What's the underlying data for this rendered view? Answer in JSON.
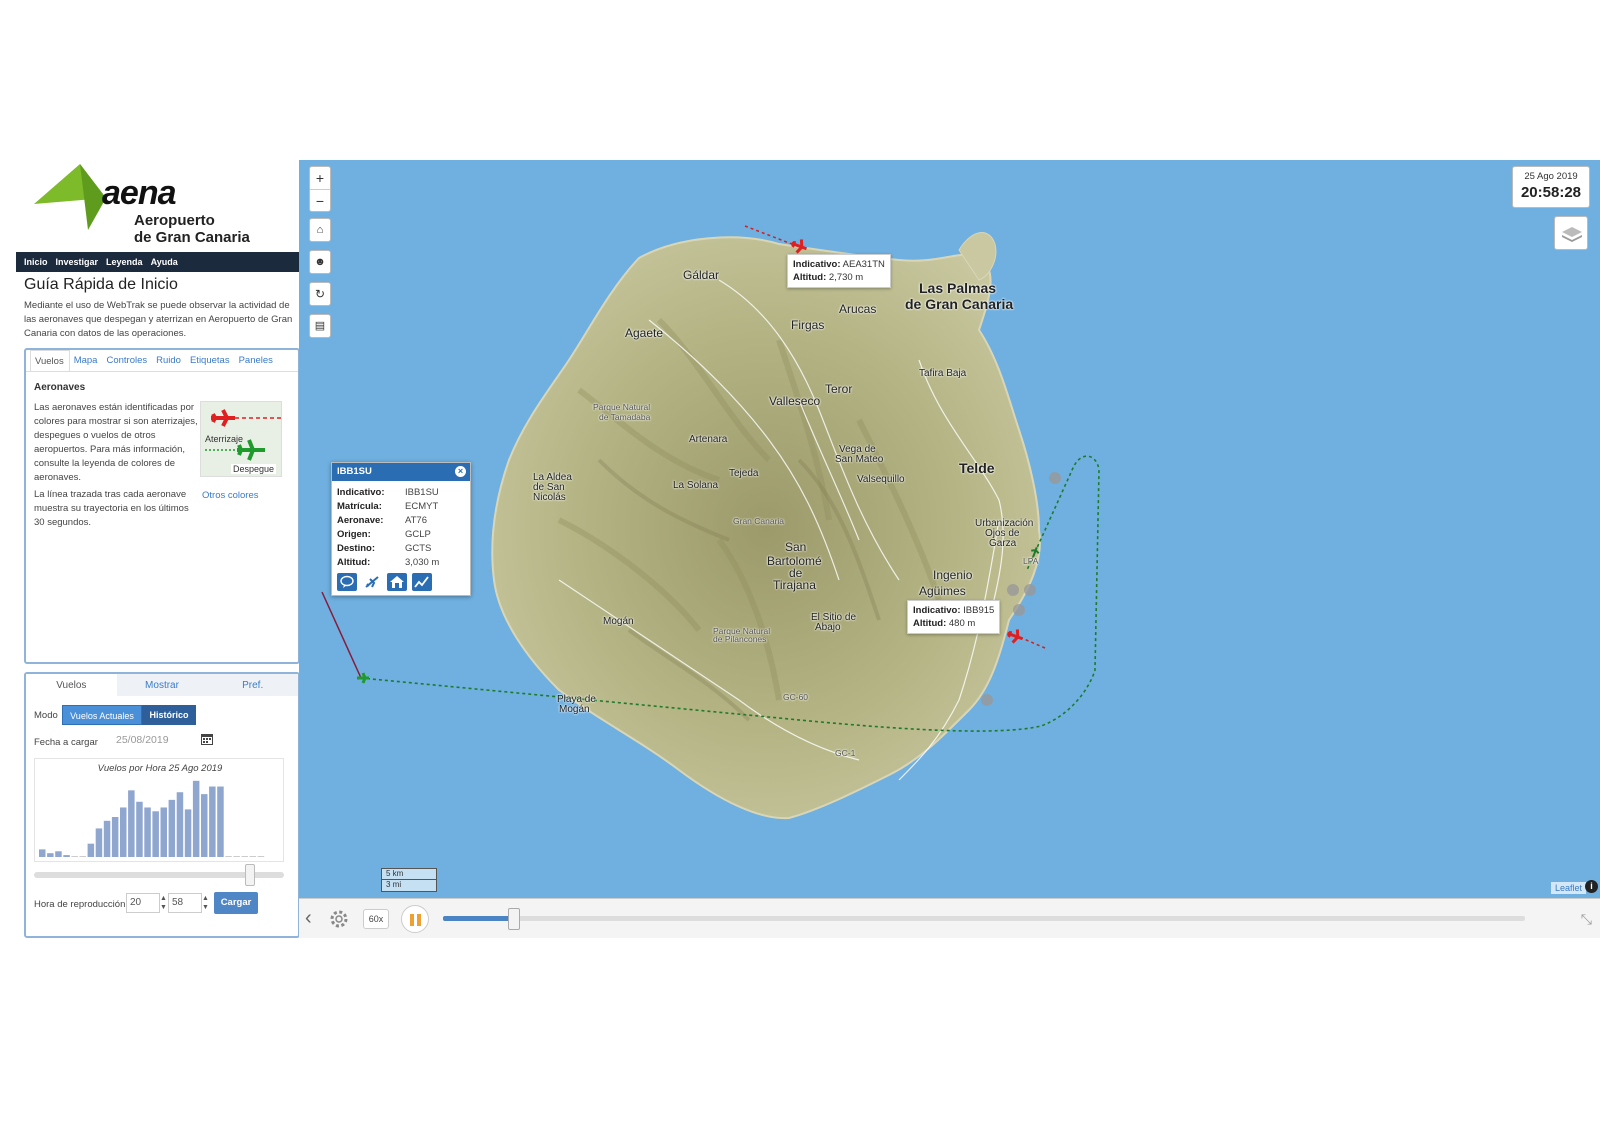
{
  "logo": {
    "brand": "aena",
    "airport_line1": "Aeropuerto",
    "airport_line2": "de Gran Canaria"
  },
  "topnav": [
    "Inicio",
    "Investigar",
    "Leyenda",
    "Ayuda"
  ],
  "guide": {
    "title": "Guía Rápida de Inicio",
    "text": "Mediante el uso de WebTrak se puede observar la actividad de las aeronaves que despegan y aterrizan en Aeropuerto de Gran Canaria con datos de las operaciones."
  },
  "help_panel": {
    "tabs": [
      "Vuelos",
      "Mapa",
      "Controles",
      "Ruido",
      "Etiquetas",
      "Paneles"
    ],
    "active_tab": 0,
    "heading": "Aeronaves",
    "p1": "Las aeronaves están identificadas por colores para mostrar si son aterrizajes, despegues o vuelos de otros aeropuertos. Para más información, consulte la leyenda de colores de aeronaves.",
    "p2": "La línea trazada tras cada aeronave muestra su trayectoria en los últimos 30 segundos.",
    "legend_landing": "Aterrizaje",
    "legend_takeoff": "Despegue",
    "other_colors": "Otros colores"
  },
  "flights_panel": {
    "tabs": [
      "Vuelos",
      "Mostrar",
      "Pref."
    ],
    "active_tab": 0,
    "mode_label": "Modo",
    "mode_current": "Vuelos Actuales",
    "mode_historic": "Histórico",
    "date_label": "Fecha a cargar",
    "date_value": "25/08/2019",
    "histogram_title": "Vuelos por Hora 25 Ago 2019",
    "histogram_values": [
      4,
      2,
      3,
      1,
      0,
      0,
      7,
      15,
      19,
      21,
      26,
      35,
      29,
      26,
      24,
      26,
      30,
      34,
      25,
      40,
      33,
      37,
      37,
      0,
      0,
      0,
      0,
      0
    ],
    "slider_fraction": 0.88,
    "hour_label": "Hora de reproducción",
    "hour": "20",
    "minute": "58",
    "load_button": "Cargar"
  },
  "map": {
    "clock_date": "25 Ago 2019",
    "clock_time": "20:58:28",
    "places": [
      {
        "name": "Gáldar",
        "cls": "mid"
      },
      {
        "name": "Arucas",
        "cls": "mid"
      },
      {
        "name": "Firgas",
        "cls": "mid"
      },
      {
        "name": "Agaete",
        "cls": "mid"
      },
      {
        "name": "Las Palmas",
        "cls": "big"
      },
      {
        "name": "de Gran Canaria",
        "cls": "big"
      },
      {
        "name": "Tafira Baja",
        "cls": ""
      },
      {
        "name": "Teror",
        "cls": "mid"
      },
      {
        "name": "Valleseco",
        "cls": "mid"
      },
      {
        "name": "Parque Natural",
        "cls": "small"
      },
      {
        "name": "de Tamadaba",
        "cls": "small"
      },
      {
        "name": "Artenara",
        "cls": ""
      },
      {
        "name": "Vega de",
        "cls": ""
      },
      {
        "name": "San Mateo",
        "cls": ""
      },
      {
        "name": "Valsequillo",
        "cls": ""
      },
      {
        "name": "Telde",
        "cls": "big"
      },
      {
        "name": "La Aldea",
        "cls": ""
      },
      {
        "name": "de San",
        "cls": ""
      },
      {
        "name": "Nicolás",
        "cls": ""
      },
      {
        "name": "La Solana",
        "cls": ""
      },
      {
        "name": "Tejeda",
        "cls": ""
      },
      {
        "name": "Gran Canaria",
        "cls": "small"
      },
      {
        "name": "Urbanización",
        "cls": ""
      },
      {
        "name": "Ojos de",
        "cls": ""
      },
      {
        "name": "Garza",
        "cls": ""
      },
      {
        "name": "San",
        "cls": "mid"
      },
      {
        "name": "Bartolomé",
        "cls": "mid"
      },
      {
        "name": "de",
        "cls": "mid"
      },
      {
        "name": "Tirajana",
        "cls": "mid"
      },
      {
        "name": "Ingenio",
        "cls": "mid"
      },
      {
        "name": "Agüimes",
        "cls": "mid"
      },
      {
        "name": "Mogán",
        "cls": ""
      },
      {
        "name": "El Sitio de",
        "cls": ""
      },
      {
        "name": "Abajo",
        "cls": ""
      },
      {
        "name": "Parque Natural",
        "cls": "small"
      },
      {
        "name": "de Pilancones",
        "cls": "small"
      },
      {
        "name": "Playa de",
        "cls": ""
      },
      {
        "name": "Mogán",
        "cls": ""
      },
      {
        "name": "GC-60",
        "cls": "small"
      },
      {
        "name": "GC-1",
        "cls": "small"
      },
      {
        "name": "LPA",
        "cls": "small"
      }
    ],
    "tooltip_top": {
      "k1": "Indicativo:",
      "v1": "AEA31TN",
      "k2": "Altitud:",
      "v2": "2,730 m"
    },
    "tooltip_bottom": {
      "k1": "Indicativo:",
      "v1": "IBB915",
      "k2": "Altitud:",
      "v2": "480 m"
    },
    "popup": {
      "title": "IBB1SU",
      "rows": [
        {
          "k": "Indicativo:",
          "v": "IBB1SU"
        },
        {
          "k": "Matrícula:",
          "v": "ECMYT"
        },
        {
          "k": "Aeronave:",
          "v": "AT76"
        },
        {
          "k": "Origen:",
          "v": "GCLP"
        },
        {
          "k": "Destino:",
          "v": "GCTS"
        },
        {
          "k": "Altitud:",
          "v": "3,030 m"
        }
      ]
    },
    "scale_km": "5 km",
    "scale_mi": "3 mi",
    "attribution": "Leaflet",
    "colors": {
      "sea": "#6fb0e0",
      "land": "#b8b98a",
      "landing": "#e02020",
      "takeoff": "#1f9a2c"
    }
  },
  "playbar": {
    "speed": "60x",
    "progress_fraction": 0.066
  }
}
